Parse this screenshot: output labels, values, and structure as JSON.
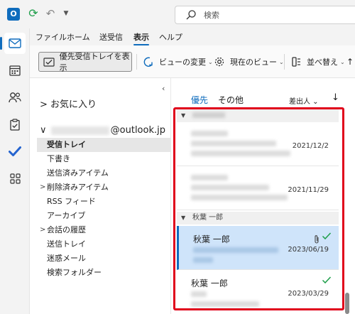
{
  "search": {
    "placeholder": "検索"
  },
  "ribbon_tabs": [
    "ファイル",
    "ホーム",
    "送受信",
    "表示",
    "ヘルプ"
  ],
  "ribbon": {
    "focused_inbox_label": "優先受信トレイを表示",
    "view_change_label": "ビューの変更",
    "current_view_label": "現在のビュー",
    "arrange_label": "並べ替え"
  },
  "folder_pane": {
    "favorites_label": "お気に入り",
    "account_suffix": "@outlook.jp",
    "folders": [
      "受信トレイ",
      "下書き",
      "送信済みアイテム",
      "削除済みアイテム",
      "RSS フィード",
      "アーカイブ",
      "会話の履歴",
      "送信トレイ",
      "迷惑メール",
      "検索フォルダー"
    ]
  },
  "message_list": {
    "tab_focused": "優先",
    "tab_other": "その他",
    "sort_label": "差出人",
    "group_sender": "秋葉 一郎",
    "messages": [
      {
        "date": "2021/12/2"
      },
      {
        "date": "2021/11/29"
      },
      {
        "sender": "秋葉 一郎",
        "date": "2023/06/19"
      },
      {
        "sender": "秋葉 一郎",
        "date": "2023/03/29"
      }
    ]
  },
  "colors": {
    "accent": "#0f6cbd",
    "highlight": "#e0001b",
    "selected_row": "#cfe4fa"
  }
}
